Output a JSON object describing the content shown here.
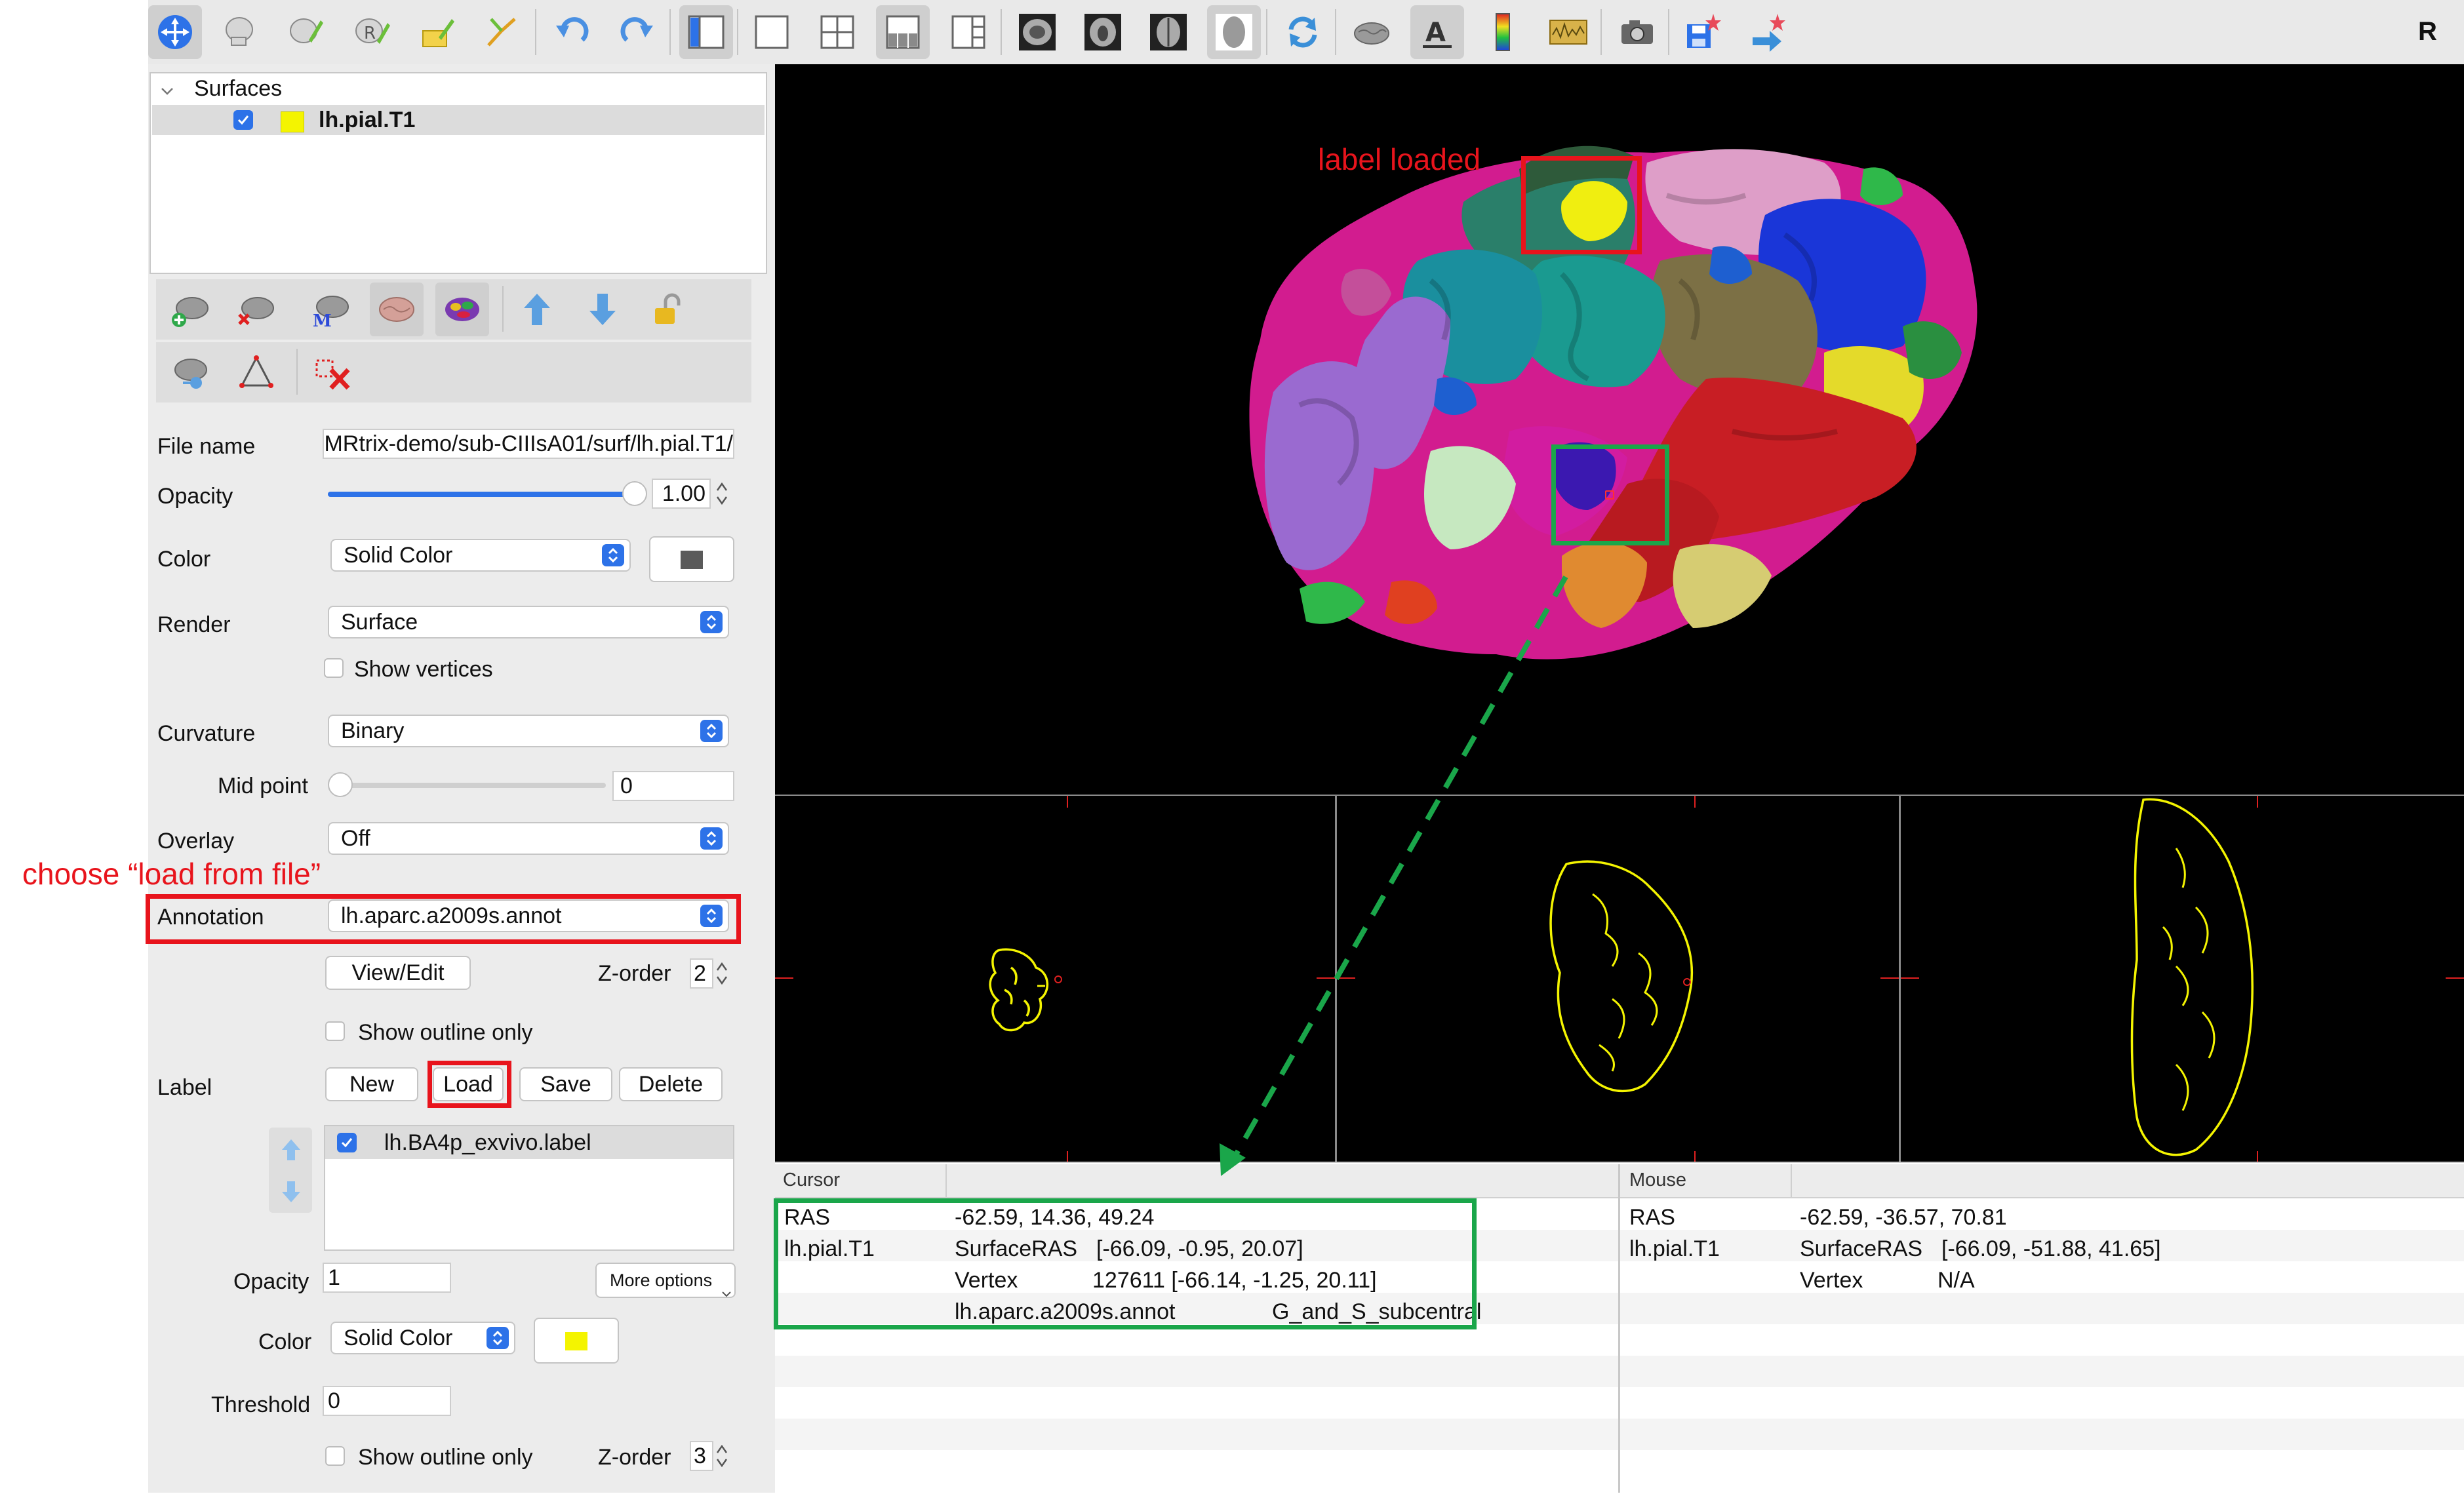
{
  "toolbar": {
    "tools": [
      "navigate-icon",
      "skull-strip-icon",
      "voxel-edit-icon",
      "recon-edit-icon",
      "roi-edit-icon",
      "point-set-edit-icon",
      "undo-icon",
      "redo-icon",
      "layout-1x3-icon",
      "layout-1x1-icon",
      "layout-2x2-icon",
      "layout-1and3-icon",
      "layout-1and3-horizontal-icon",
      "view-sagittal-icon",
      "view-coronal-icon",
      "view-axial-icon",
      "view-3d-icon",
      "reset-view-icon",
      "surface-icon",
      "text-annotation-icon",
      "color-bar-icon",
      "frame-icon",
      "snapshot-icon",
      "save-point-icon",
      "transform-icon"
    ],
    "orientation_label": "R"
  },
  "layers": {
    "group_label": "Surfaces",
    "item_label": "lh.pial.T1",
    "item_color": "#f4f400"
  },
  "props": {
    "file_name_label": "File name",
    "file_name_value": "/MRtrix-demo/sub-CIIIsA01/surf/lh.pial.T1",
    "opacity_label": "Opacity",
    "opacity_value": "1.00",
    "opacity_fraction": 1.0,
    "color_label": "Color",
    "color_value": "Solid Color",
    "color_swatch": "#5a5a5a",
    "render_label": "Render",
    "render_value": "Surface",
    "show_vertices_label": "Show vertices",
    "curvature_label": "Curvature",
    "curvature_value": "Binary",
    "mid_point_label": "Mid point",
    "mid_point_value": "0",
    "overlay_label": "Overlay",
    "overlay_value": "Off",
    "annotation_label": "Annotation",
    "annotation_value": "lh.aparc.a2009s.annot",
    "view_edit_label": "View/Edit",
    "zorder_label": "Z-order",
    "annot_zorder_value": "2",
    "show_outline_label": "Show outline only",
    "label_label": "Label",
    "new_label": "New",
    "load_label": "Load",
    "save_label": "Save",
    "delete_label": "Delete",
    "label_item": "lh.BA4p_exvivo.label",
    "label_opacity_label": "Opacity",
    "label_opacity_value": "1",
    "more_options_label": "More options",
    "label_color_label": "Color",
    "label_color_value": "Solid Color",
    "label_color_swatch": "#f4f400",
    "threshold_label": "Threshold",
    "threshold_value": "0",
    "label_show_outline_label": "Show outline only",
    "label_zorder_label": "Z-order",
    "label_zorder_value": "3"
  },
  "annotations": {
    "choose_load_from_file": "choose “load from file”",
    "label_loaded": "label loaded"
  },
  "info_cursor": {
    "header": "Cursor",
    "rows": [
      {
        "name": "RAS",
        "key": "",
        "value": "-62.59, 14.36, 49.24"
      },
      {
        "name": "lh.pial.T1",
        "key": "SurfaceRAS",
        "value": "[-66.09, -0.95, 20.07]"
      },
      {
        "name": "",
        "key": "Vertex",
        "value": "127611  [-66.14, -1.25, 20.11]"
      },
      {
        "name": "",
        "key": "lh.aparc.a2009s.annot",
        "value": "G_and_S_subcentral"
      }
    ]
  },
  "info_mouse": {
    "header": "Mouse",
    "rows": [
      {
        "name": "RAS",
        "key": "",
        "value": "-62.59, -36.57, 70.81"
      },
      {
        "name": "lh.pial.T1",
        "key": "SurfaceRAS",
        "value": "[-66.09, -51.88, 41.65]"
      },
      {
        "name": "",
        "key": "Vertex",
        "value": "N/A"
      }
    ]
  },
  "colors": {
    "highlight_red": "#e8141c",
    "highlight_green": "#1aa64a",
    "accent_blue": "#2d72e8",
    "outline_yellow": "#f4f400"
  }
}
